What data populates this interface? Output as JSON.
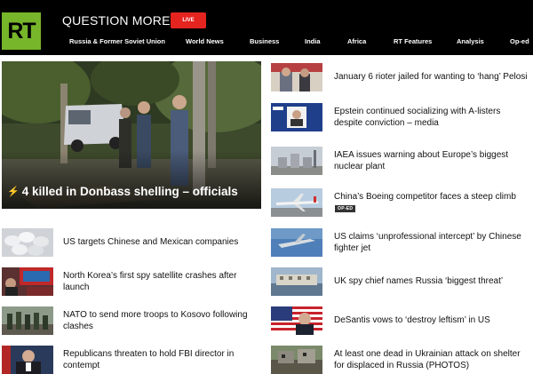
{
  "header": {
    "logo": "RT",
    "tagline": "QUESTION MORE",
    "live_label": "LIVE",
    "nav": [
      "Russia & Former Soviet Union",
      "World News",
      "Business",
      "India",
      "Africa",
      "RT Features",
      "Analysis",
      "Op-ed"
    ]
  },
  "hero": {
    "title": "4 killed in Donbass shelling – officials"
  },
  "left_stories": [
    "US targets Chinese and Mexican companies",
    "North Korea’s first spy satellite crashes after launch",
    "NATO to send more troops to Kosovo following clashes",
    "Republicans threaten to hold FBI director in contempt"
  ],
  "right_stories": [
    "January 6 rioter jailed for wanting to ‘hang’ Pelosi",
    "Epstein continued socializing with A-listers despite conviction – media",
    "IAEA issues warning about Europe’s biggest nuclear plant",
    "China’s Boeing competitor faces a steep climb",
    "US claims ‘unprofessional intercept’ by Chinese fighter jet",
    "UK spy chief names Russia ‘biggest threat’",
    "DeSantis vows to ‘destroy leftism’ in US",
    "At least one dead in Ukrainian attack on shelter for displaced in Russia (PHOTOS)"
  ],
  "badges": {
    "op_ed": "OP-ED"
  },
  "colors": {
    "header_bg": "#000000",
    "logo_green": "#77b52a",
    "live_red": "#e52420"
  }
}
